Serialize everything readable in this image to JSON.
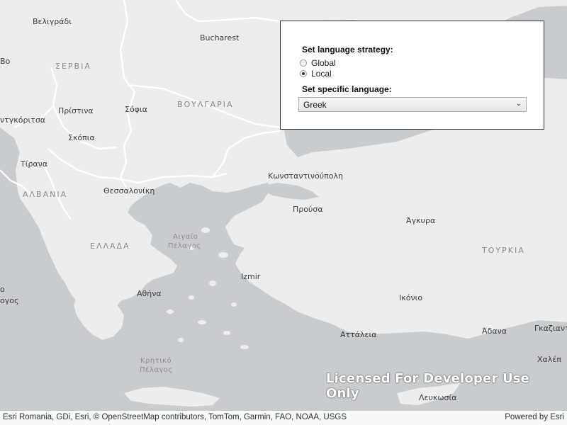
{
  "map": {
    "labels": {
      "belgrade": "Βελιγράδι",
      "bucharest": "Bucharest",
      "serbia": "ΣΕΡΒΙΑ",
      "pristina": "Πρίστινα",
      "sofia": "Σόφια",
      "bulgaria": "ΒΟΥΛΓΑΡΙΑ",
      "podgorica": "ντγκόριτσα",
      "skopje": "Σκόπια",
      "tirana": "Τίρανα",
      "albania": "ΑΛΒΑΝΙΑ",
      "thessaloniki": "Θεσσαλονίκη",
      "istanbul": "Κωνσταντινούπολη",
      "bursa": "Προύσα",
      "ankara": "Άγκυρα",
      "aegean_1": "Αιγαίο",
      "aegean_2": "Πέλαγος",
      "greece": "ΕΛΛΑΔΑ",
      "turkey": "ΤΟΥΡΚΙΑ",
      "izmir": "Izmir",
      "athens": "Αθήνα",
      "konya": "Ικόνιο",
      "antalya": "Αττάλεια",
      "adana": "Άδανα",
      "gaziantep": "Γκαζιαντ",
      "aleppo": "Χαλέπ",
      "cretan_1": "Κρητικό",
      "cretan_2": "Πέλαγος",
      "nicosia": "Λευκωσία",
      "edge_left_1": "ο",
      "edge_left_2": "ογος",
      "edge_left_3": "Βο"
    },
    "colors": {
      "land": "#ededed",
      "sea": "#c9ccce",
      "border": "#ffffff"
    }
  },
  "panel": {
    "strategy_heading": "Set language strategy:",
    "options": [
      {
        "label": "Global",
        "checked": false
      },
      {
        "label": "Local",
        "checked": true
      }
    ],
    "language_heading": "Set specific language:",
    "language_selected": "Greek"
  },
  "watermark": "Licensed For Developer Use Only",
  "attribution": {
    "left": "Esri Romania, GDi, Esri, © OpenStreetMap contributors, TomTom, Garmin, FAO, NOAA, USGS",
    "right": "Powered by Esri"
  }
}
